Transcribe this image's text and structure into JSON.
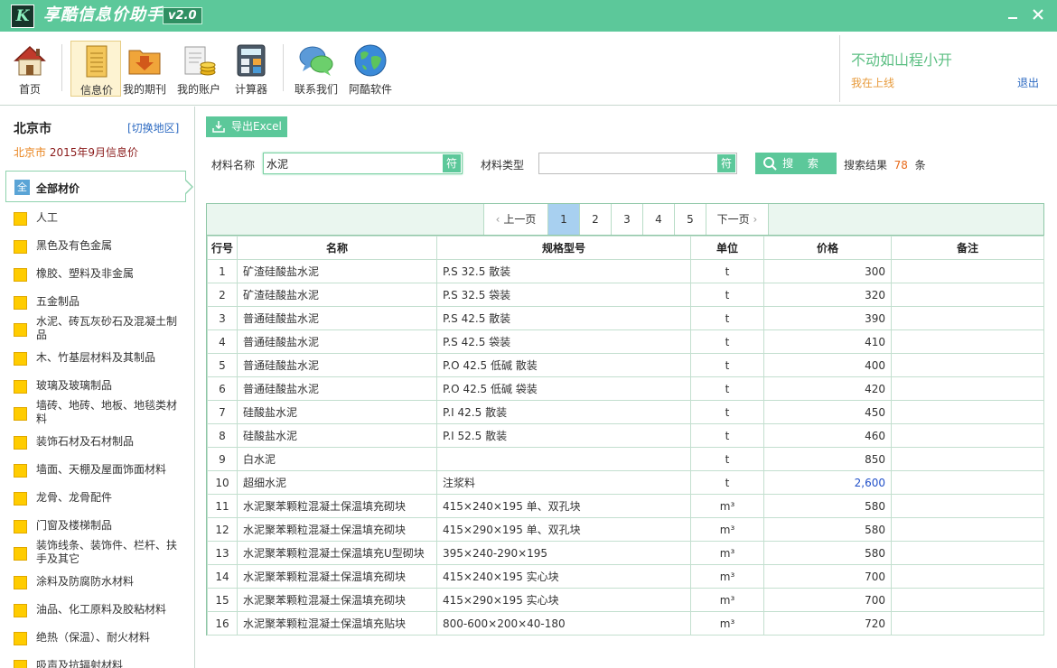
{
  "app": {
    "title": "享酷信息价助手",
    "version": "v2.0",
    "logo_text": "K"
  },
  "window": {
    "minimize_icon": "minimize-icon",
    "close_icon": "close-icon"
  },
  "toolbar": {
    "items": [
      {
        "label": "首页",
        "icon": "house-icon"
      },
      {
        "label": "信息价",
        "icon": "document-icon"
      },
      {
        "label": "我的期刊",
        "icon": "folder-download-icon"
      },
      {
        "label": "我的账户",
        "icon": "wallet-coins-icon"
      },
      {
        "label": "计算器",
        "icon": "calculator-icon"
      },
      {
        "label": "联系我们",
        "icon": "chat-bubbles-icon"
      },
      {
        "label": "阿酷软件",
        "icon": "globe-icon"
      }
    ]
  },
  "user": {
    "name": "不动如山程小开",
    "status": "我在上线",
    "logout": "退出"
  },
  "sidebar": {
    "city": "北京市",
    "switch_region": "[切换地区]",
    "period_city": "北京市",
    "period_text": "2015年9月信息价",
    "all_icon_text": "全",
    "all_label": "全部材价",
    "categories": [
      "人工",
      "黑色及有色金属",
      "橡胶、塑料及非金属",
      "五金制品",
      "水泥、砖瓦灰砂石及混凝土制品",
      "木、竹基层材料及其制品",
      "玻璃及玻璃制品",
      "墙砖、地砖、地板、地毯类材料",
      "装饰石材及石材制品",
      "墙面、天棚及屋面饰面材料",
      "龙骨、龙骨配件",
      "门窗及楼梯制品",
      "装饰线条、装饰件、栏杆、扶手及其它",
      "涂料及防腐防水材料",
      "油品、化工原料及胶粘材料",
      "绝热（保温）、耐火材料",
      "吸声及抗辐射材料"
    ]
  },
  "toolbar2": {
    "export_label": "导出Excel"
  },
  "search": {
    "name_label": "材料名称",
    "name_value": "水泥",
    "type_label": "材料类型",
    "type_value": "",
    "symbol_button": "符",
    "search_button": "搜 索",
    "result_prefix": "搜索结果",
    "result_count": "78",
    "result_suffix": "条"
  },
  "pager": {
    "prev": "上一页",
    "next": "下一页",
    "pages": [
      "1",
      "2",
      "3",
      "4",
      "5"
    ],
    "current": "1"
  },
  "table": {
    "columns": [
      "行号",
      "名称",
      "规格型号",
      "单位",
      "价格",
      "备注"
    ],
    "rows": [
      {
        "no": "1",
        "name": "矿渣硅酸盐水泥",
        "spec": "P.S 32.5 散装",
        "unit": "t",
        "price": "300",
        "note": ""
      },
      {
        "no": "2",
        "name": "矿渣硅酸盐水泥",
        "spec": "P.S 32.5 袋装",
        "unit": "t",
        "price": "320",
        "note": ""
      },
      {
        "no": "3",
        "name": "普通硅酸盐水泥",
        "spec": "P.S 42.5 散装",
        "unit": "t",
        "price": "390",
        "note": ""
      },
      {
        "no": "4",
        "name": "普通硅酸盐水泥",
        "spec": "P.S 42.5 袋装",
        "unit": "t",
        "price": "410",
        "note": ""
      },
      {
        "no": "5",
        "name": "普通硅酸盐水泥",
        "spec": "P.O 42.5 低碱 散装",
        "unit": "t",
        "price": "400",
        "note": ""
      },
      {
        "no": "6",
        "name": "普通硅酸盐水泥",
        "spec": "P.O 42.5 低碱 袋装",
        "unit": "t",
        "price": "420",
        "note": ""
      },
      {
        "no": "7",
        "name": "硅酸盐水泥",
        "spec": "P.I 42.5 散装",
        "unit": "t",
        "price": "450",
        "note": ""
      },
      {
        "no": "8",
        "name": "硅酸盐水泥",
        "spec": "P.I 52.5 散装",
        "unit": "t",
        "price": "460",
        "note": ""
      },
      {
        "no": "9",
        "name": "白水泥",
        "spec": "",
        "unit": "t",
        "price": "850",
        "note": ""
      },
      {
        "no": "10",
        "name": "超细水泥",
        "spec": "注浆料",
        "unit": "t",
        "price": "2,600",
        "note": ""
      },
      {
        "no": "11",
        "name": "水泥聚苯颗粒混凝土保温填充砌块",
        "spec": "415×240×195 单、双孔块",
        "unit": "m³",
        "price": "580",
        "note": ""
      },
      {
        "no": "12",
        "name": "水泥聚苯颗粒混凝土保温填充砌块",
        "spec": "415×290×195 单、双孔块",
        "unit": "m³",
        "price": "580",
        "note": ""
      },
      {
        "no": "13",
        "name": "水泥聚苯颗粒混凝土保温填充U型砌块",
        "spec": "395×240-290×195",
        "unit": "m³",
        "price": "580",
        "note": ""
      },
      {
        "no": "14",
        "name": "水泥聚苯颗粒混凝土保温填充砌块",
        "spec": "415×240×195 实心块",
        "unit": "m³",
        "price": "700",
        "note": ""
      },
      {
        "no": "15",
        "name": "水泥聚苯颗粒混凝土保温填充砌块",
        "spec": "415×290×195 实心块",
        "unit": "m³",
        "price": "700",
        "note": ""
      },
      {
        "no": "16",
        "name": "水泥聚苯颗粒混凝土保温填充贴块",
        "spec": "800-600×200×40-180",
        "unit": "m³",
        "price": "720",
        "note": ""
      }
    ]
  }
}
